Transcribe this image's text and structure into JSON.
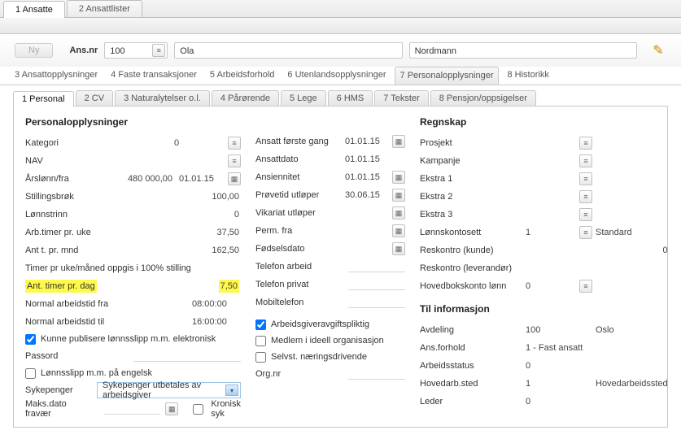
{
  "topTabs": {
    "t1": "1 Ansatte",
    "t2": "2 Ansattlister"
  },
  "header": {
    "ny": "Ny",
    "ansnr_label": "Ans.nr",
    "ansnr": "100",
    "first_name": "Ola",
    "last_name": "Nordmann"
  },
  "mainTabs": {
    "t3": "3 Ansattopplysninger",
    "t4": "4 Faste transaksjoner",
    "t5": "5 Arbeidsforhold",
    "t6": "6 Utenlandsopplysninger",
    "t7": "7 Personalopplysninger",
    "t8": "8 Historikk"
  },
  "subTabs": {
    "s1": "1 Personal",
    "s2": "2 CV",
    "s3": "3 Naturalytelser o.l.",
    "s4": "4 Pårørende",
    "s5": "5 Lege",
    "s6": "6 HMS",
    "s7": "7 Tekster",
    "s8": "8 Pensjon/oppsigelser"
  },
  "left": {
    "heading": "Personalopplysninger",
    "kategori_lbl": "Kategori",
    "kategori_val": "0",
    "nav_lbl": "NAV",
    "arslonn_lbl": "Årslønn/fra",
    "arslonn_val": "480 000,00",
    "arslonn_date": "01.01.15",
    "stillingsbrok_lbl": "Stillingsbrøk",
    "stillingsbrok_val": "100,00",
    "lonnstrinn_lbl": "Lønnstrinn",
    "lonnstrinn_val": "0",
    "arbtimer_lbl": "Arb.timer pr. uke",
    "arbtimer_val": "37,50",
    "anttmnd_lbl": "Ant t. pr. mnd",
    "anttmnd_val": "162,50",
    "timeruke_lbl": "Timer pr uke/måned oppgis i 100% stilling",
    "timerdag_lbl": "Ant. timer pr. dag",
    "timerdag_val": "7,50",
    "arbfra_lbl": "Normal arbeidstid fra",
    "arbfra_val": "08:00:00",
    "arbtil_lbl": "Normal arbeidstid til",
    "arbtil_val": "16:00:00",
    "publisere_lbl": "Kunne publisere lønnsslipp m.m. elektronisk",
    "passord_lbl": "Passord",
    "engelsk_lbl": "Lønnsslipp m.m. på engelsk",
    "sykepenger_lbl": "Sykepenger",
    "sykepenger_combo": "Sykepenger utbetales av arbeidsgiver",
    "maksdato_lbl": "Maks.dato fravær",
    "kronisk_lbl": "Kronisk syk"
  },
  "mid": {
    "ansattforste_lbl": "Ansatt første gang",
    "ansattforste_val": "01.01.15",
    "ansattdato_lbl": "Ansattdato",
    "ansattdato_val": "01.01.15",
    "ansiennitet_lbl": "Ansiennitet",
    "ansiennitet_val": "01.01.15",
    "provetid_lbl": "Prøvetid utløper",
    "provetid_val": "30.06.15",
    "vikariat_lbl": "Vikariat utløper",
    "permfra_lbl": "Perm. fra",
    "fodselsdato_lbl": "Fødselsdato",
    "telarbeid_lbl": "Telefon arbeid",
    "telprivat_lbl": "Telefon privat",
    "mobil_lbl": "Mobiltelefon",
    "avgift_lbl": "Arbeidsgiveravgiftspliktig",
    "ideell_lbl": "Medlem i ideell organisasjon",
    "selvst_lbl": "Selvst. næringsdrivende",
    "orgnr_lbl": "Org.nr"
  },
  "right": {
    "regnskap_heading": "Regnskap",
    "prosjekt_lbl": "Prosjekt",
    "kampanje_lbl": "Kampanje",
    "ekstra1_lbl": "Ekstra 1",
    "ekstra2_lbl": "Ekstra 2",
    "ekstra3_lbl": "Ekstra 3",
    "lonnskonto_lbl": "Lønnskontosett",
    "lonnskonto_val": "1",
    "lonnskonto_extra": "Standard",
    "reskontrok_lbl": "Reskontro (kunde)",
    "reskontrok_val": "0",
    "reskontrol_lbl": "Reskontro (leverandør)",
    "hovedbok_lbl": "Hovedbokskonto lønn",
    "hovedbok_val": "0",
    "tilinfo_heading": "Til informasjon",
    "avdeling_lbl": "Avdeling",
    "avdeling_val": "100",
    "avdeling_extra": "Oslo",
    "ansforhold_lbl": "Ans.forhold",
    "ansforhold_val": "1 - Fast ansatt",
    "arbeidsstatus_lbl": "Arbeidsstatus",
    "arbeidsstatus_val": "0",
    "hovedarb_lbl": "Hovedarb.sted",
    "hovedarb_val": "1",
    "hovedarb_extra": "Hovedarbeidssted",
    "leder_lbl": "Leder",
    "leder_val": "0"
  }
}
